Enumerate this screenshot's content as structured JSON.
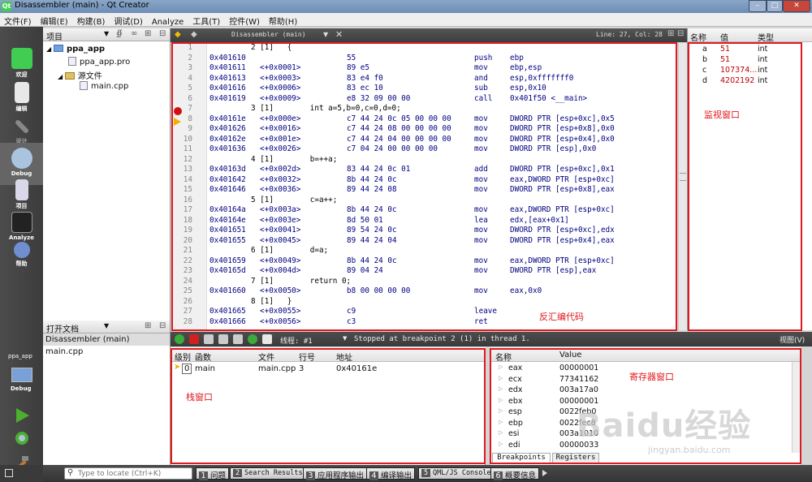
{
  "window": {
    "title": "Disassembler (main) - Qt Creator",
    "logo": "Qt"
  },
  "menu": [
    "文件(F)",
    "编辑(E)",
    "构建(B)",
    "调试(D)",
    "Analyze",
    "工具(T)",
    "控件(W)",
    "帮助(H)"
  ],
  "modes": [
    {
      "label": "欢迎",
      "icon": "qt-welcome-icon"
    },
    {
      "label": "编辑",
      "icon": "edit-icon"
    },
    {
      "label": "设计",
      "icon": "design-icon"
    },
    {
      "label": "Debug",
      "icon": "debug-icon"
    },
    {
      "label": "项目",
      "icon": "projects-icon"
    },
    {
      "label": "Analyze",
      "icon": "analyze-icon"
    },
    {
      "label": "帮助",
      "icon": "help-icon"
    }
  ],
  "kit": {
    "project": "ppa_app",
    "mode": "Debug"
  },
  "project_pane": {
    "title": "项目",
    "tree": [
      "ppa_app",
      "ppa_app.pro",
      "源文件",
      "main.cpp"
    ]
  },
  "open_docs": {
    "title": "打开文档",
    "selected": "Disassembler (main)",
    "items": [
      "main.cpp"
    ]
  },
  "editor": {
    "tab": "Disassembler (main)",
    "position": "Line: 27, Col: 28",
    "lines": [
      {
        "n": "1",
        "src": "2 [1]   {"
      },
      {
        "n": "2",
        "a": "0x401610",
        "b": "",
        "h": "55",
        "op": "push",
        "arg": "ebp"
      },
      {
        "n": "3",
        "a": "0x401611",
        "b": "<+0x0001>",
        "h": "89 e5",
        "op": "mov",
        "arg": "ebp,esp"
      },
      {
        "n": "4",
        "a": "0x401613",
        "b": "<+0x0003>",
        "h": "83 e4 f0",
        "op": "and",
        "arg": "esp,0xfffffff0"
      },
      {
        "n": "5",
        "a": "0x401616",
        "b": "<+0x0006>",
        "h": "83 ec 10",
        "op": "sub",
        "arg": "esp,0x10"
      },
      {
        "n": "6",
        "a": "0x401619",
        "b": "<+0x0009>",
        "h": "e8 32 09 00 00",
        "op": "call",
        "arg": "0x401f50 <__main>"
      },
      {
        "n": "7",
        "src": "3 [1]        int a=5,b=0,c=0,d=0;"
      },
      {
        "n": "8",
        "a": "0x40161e",
        "b": "<+0x000e>",
        "h": "c7 44 24 0c 05 00 00 00",
        "op": "mov",
        "arg": "DWORD PTR [esp+0xc],0x5"
      },
      {
        "n": "9",
        "a": "0x401626",
        "b": "<+0x0016>",
        "h": "c7 44 24 08 00 00 00 00",
        "op": "mov",
        "arg": "DWORD PTR [esp+0x8],0x0"
      },
      {
        "n": "10",
        "a": "0x40162e",
        "b": "<+0x001e>",
        "h": "c7 44 24 04 00 00 00 00",
        "op": "mov",
        "arg": "DWORD PTR [esp+0x4],0x0"
      },
      {
        "n": "11",
        "a": "0x401636",
        "b": "<+0x0026>",
        "h": "c7 04 24 00 00 00 00",
        "op": "mov",
        "arg": "DWORD PTR [esp],0x0"
      },
      {
        "n": "12",
        "src": "4 [1]        b=++a;"
      },
      {
        "n": "13",
        "a": "0x40163d",
        "b": "<+0x002d>",
        "h": "83 44 24 0c 01",
        "op": "add",
        "arg": "DWORD PTR [esp+0xc],0x1"
      },
      {
        "n": "14",
        "a": "0x401642",
        "b": "<+0x0032>",
        "h": "8b 44 24 0c",
        "op": "mov",
        "arg": "eax,DWORD PTR [esp+0xc]"
      },
      {
        "n": "15",
        "a": "0x401646",
        "b": "<+0x0036>",
        "h": "89 44 24 08",
        "op": "mov",
        "arg": "DWORD PTR [esp+0x8],eax"
      },
      {
        "n": "16",
        "src": "5 [1]        c=a++;"
      },
      {
        "n": "17",
        "a": "0x40164a",
        "b": "<+0x003a>",
        "h": "8b 44 24 0c",
        "op": "mov",
        "arg": "eax,DWORD PTR [esp+0xc]"
      },
      {
        "n": "18",
        "a": "0x40164e",
        "b": "<+0x003e>",
        "h": "8d 50 01",
        "op": "lea",
        "arg": "edx,[eax+0x1]"
      },
      {
        "n": "19",
        "a": "0x401651",
        "b": "<+0x0041>",
        "h": "89 54 24 0c",
        "op": "mov",
        "arg": "DWORD PTR [esp+0xc],edx"
      },
      {
        "n": "20",
        "a": "0x401655",
        "b": "<+0x0045>",
        "h": "89 44 24 04",
        "op": "mov",
        "arg": "DWORD PTR [esp+0x4],eax"
      },
      {
        "n": "21",
        "src": "6 [1]        d=a;"
      },
      {
        "n": "22",
        "a": "0x401659",
        "b": "<+0x0049>",
        "h": "8b 44 24 0c",
        "op": "mov",
        "arg": "eax,DWORD PTR [esp+0xc]"
      },
      {
        "n": "23",
        "a": "0x40165d",
        "b": "<+0x004d>",
        "h": "89 04 24",
        "op": "mov",
        "arg": "DWORD PTR [esp],eax"
      },
      {
        "n": "24",
        "src": "7 [1]        return 0;"
      },
      {
        "n": "25",
        "a": "0x401660",
        "b": "<+0x0050>",
        "h": "b8 00 00 00 00",
        "op": "mov",
        "arg": "eax,0x0"
      },
      {
        "n": "26",
        "src": "8 [1]   }"
      },
      {
        "n": "27",
        "a": "0x401665",
        "b": "<+0x0055>",
        "h": "c9",
        "op": "leave",
        "arg": ""
      },
      {
        "n": "28",
        "a": "0x401666",
        "b": "<+0x0056>",
        "h": "c3",
        "op": "ret",
        "arg": ""
      }
    ]
  },
  "watch": {
    "headers": [
      "名称",
      "值",
      "类型"
    ],
    "rows": [
      {
        "name": "a",
        "value": "51",
        "type": "int"
      },
      {
        "name": "b",
        "value": "51",
        "type": "int"
      },
      {
        "name": "c",
        "value": "107374...",
        "type": "int"
      },
      {
        "name": "d",
        "value": "4202192",
        "type": "int"
      }
    ]
  },
  "debug_toolbar": {
    "thread_label": "线程: #1",
    "status": "Stopped at breakpoint 2 (1) in thread 1.",
    "view": "视图(V)"
  },
  "stack": {
    "headers": [
      "级别",
      "函数",
      "文件",
      "行号",
      "地址"
    ],
    "rows": [
      {
        "level": "0",
        "func": "main",
        "file": "main.cpp",
        "line": "3",
        "addr": "0x40161e"
      }
    ]
  },
  "registers": {
    "headers": [
      "名称",
      "Value"
    ],
    "rows": [
      {
        "name": "eax",
        "value": "00000001"
      },
      {
        "name": "ecx",
        "value": "77341162"
      },
      {
        "name": "edx",
        "value": "003a17a0"
      },
      {
        "name": "ebx",
        "value": "00000001"
      },
      {
        "name": "esp",
        "value": "0022feb0"
      },
      {
        "name": "ebp",
        "value": "0022fec8"
      },
      {
        "name": "esi",
        "value": "003a1010"
      },
      {
        "name": "edi",
        "value": "00000033"
      }
    ],
    "tabs": [
      "Breakpoints",
      "Registers"
    ]
  },
  "statusbar": {
    "locator_placeholder": "Type to locate (Ctrl+K)",
    "tabs": [
      {
        "n": "1",
        "label": "问题"
      },
      {
        "n": "2",
        "label": "Search Results"
      },
      {
        "n": "3",
        "label": "应用程序输出"
      },
      {
        "n": "4",
        "label": "编译输出"
      },
      {
        "n": "5",
        "label": "QML/JS Console"
      },
      {
        "n": "6",
        "label": "概要信息"
      }
    ]
  },
  "annotations": {
    "watch": "监视窗口",
    "disasm": "反汇编代码",
    "stack": "栈窗口",
    "registers": "寄存器窗口"
  },
  "watermark": {
    "logo": "Baidu经验",
    "url": "jingyan.baidu.com"
  },
  "colors": {
    "annotation": "#e0191e",
    "breakpoint": "#d01010",
    "pc_arrow": "#f0b000"
  }
}
